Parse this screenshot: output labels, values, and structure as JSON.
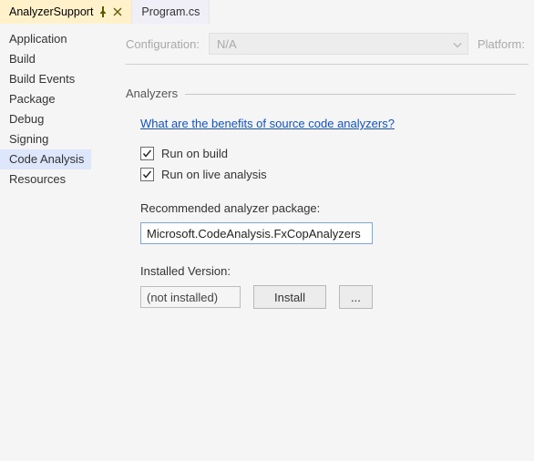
{
  "tabs": {
    "active": {
      "label": "AnalyzerSupport"
    },
    "inactive": {
      "label": "Program.cs"
    }
  },
  "sidebar": {
    "items": [
      {
        "label": "Application"
      },
      {
        "label": "Build"
      },
      {
        "label": "Build Events"
      },
      {
        "label": "Package"
      },
      {
        "label": "Debug"
      },
      {
        "label": "Signing"
      },
      {
        "label": "Code Analysis"
      },
      {
        "label": "Resources"
      }
    ],
    "selected_index": 6
  },
  "config_bar": {
    "configuration_label": "Configuration:",
    "configuration_value": "N/A",
    "platform_label": "Platform:"
  },
  "analyzers": {
    "heading": "Analyzers",
    "benefits_link": "What are the benefits of source code analyzers?",
    "run_on_build": {
      "label": "Run on build",
      "checked": true
    },
    "run_on_live": {
      "label": "Run on live analysis",
      "checked": true
    },
    "recommended_label": "Recommended analyzer package:",
    "recommended_value": "Microsoft.CodeAnalysis.FxCopAnalyzers",
    "installed_label": "Installed Version:",
    "installed_value": "(not installed)",
    "install_button": "Install",
    "ellipsis_button": "..."
  }
}
